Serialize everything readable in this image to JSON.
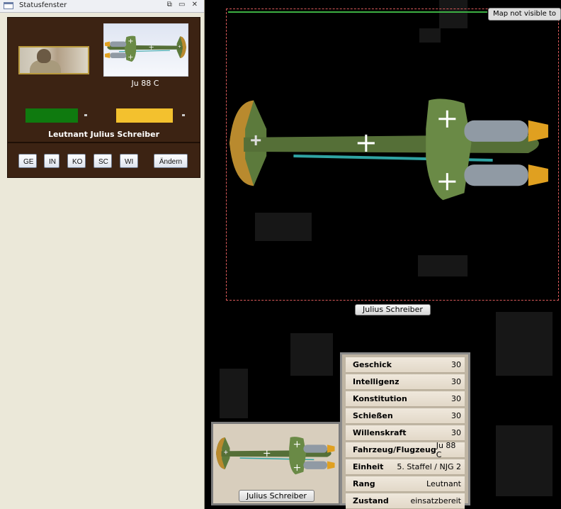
{
  "window": {
    "title": "Statusfenster",
    "controls": {
      "restore": "⧉",
      "pin": "▭",
      "close": "✕"
    }
  },
  "unit": {
    "aircraft": "Ju 88 C",
    "pilot_full": "Leutnant Julius Schreiber",
    "pilot_name": "Julius Schreiber",
    "health_fraction": 1.0,
    "morale_fraction": 1.0
  },
  "attribute_buttons": [
    "GE",
    "IN",
    "KO",
    "SC",
    "WI"
  ],
  "change_button": "Ändern",
  "map": {
    "notice": "Map not visible to"
  },
  "stats": [
    {
      "label": "Geschick",
      "value": "30"
    },
    {
      "label": "Intelligenz",
      "value": "30"
    },
    {
      "label": "Konstitution",
      "value": "30"
    },
    {
      "label": "Schießen",
      "value": "30"
    },
    {
      "label": "Willenskraft",
      "value": "30"
    },
    {
      "label": "Fahrzeug/Flugzeug",
      "value": "Ju 88 C"
    },
    {
      "label": "Einheit",
      "value": "5. Staffel / NJG 2"
    },
    {
      "label": "Rang",
      "value": "Leutnant"
    },
    {
      "label": "Zustand",
      "value": "einsatzbereit"
    }
  ],
  "colors": {
    "health": "#0f7a0f",
    "morale": "#f3c12e",
    "panel": "#3c2313"
  }
}
